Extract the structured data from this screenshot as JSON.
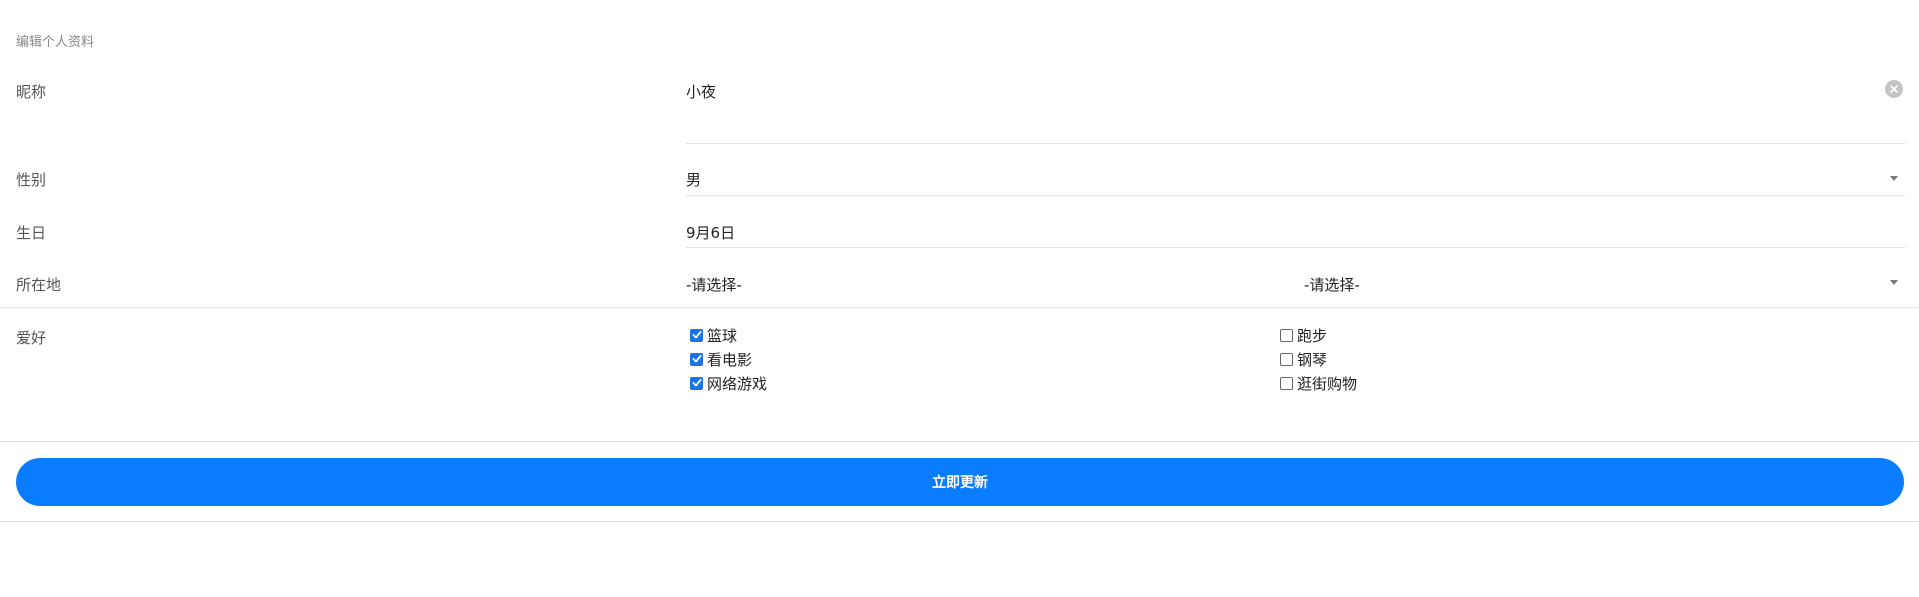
{
  "page": {
    "heading": "编辑个人资料"
  },
  "form": {
    "nickname": {
      "label": "昵称",
      "value": "小夜"
    },
    "gender": {
      "label": "性别",
      "value": "男"
    },
    "birthday": {
      "label": "生日",
      "value": "9月6日"
    },
    "location": {
      "label": "所在地",
      "province": "-请选择-",
      "city": "-请选择-"
    },
    "hobbies": {
      "label": "爱好",
      "options": [
        {
          "label": "篮球",
          "checked": true
        },
        {
          "label": "看电影",
          "checked": true
        },
        {
          "label": "网络游戏",
          "checked": true
        },
        {
          "label": "跑步",
          "checked": false
        },
        {
          "label": "钢琴",
          "checked": false
        },
        {
          "label": "逛街购物",
          "checked": false
        }
      ]
    }
  },
  "actions": {
    "submit_label": "立即更新"
  },
  "colors": {
    "accent": "#0a7cff",
    "checkbox_checked": "#1a73e8"
  }
}
